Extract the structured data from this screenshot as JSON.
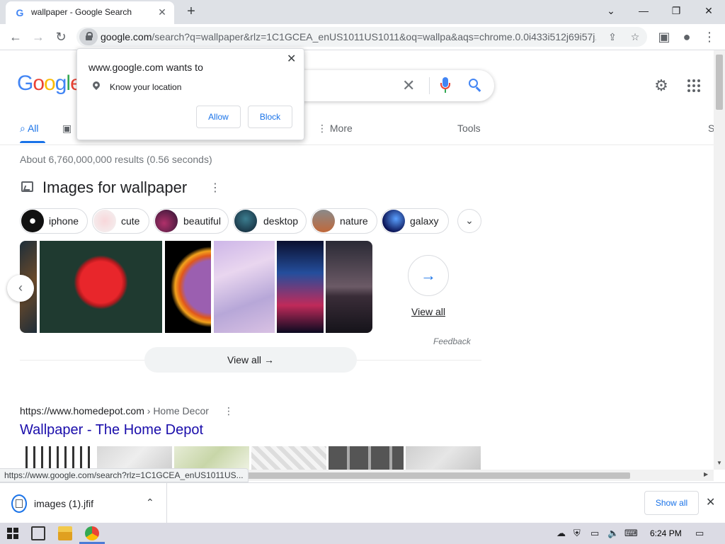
{
  "browser": {
    "tab_title": "wallpaper - Google Search",
    "favicon_letter": "G",
    "url_host": "google.com",
    "url_rest": "/search?q=wallpaper&rlz=1C1GCEA_enUS1011US1011&oq=wallpa&aqs=chrome.0.0i433i512j69i57j..."
  },
  "google": {
    "logo_letters": [
      "G",
      "o",
      "o",
      "g",
      "l",
      "e"
    ],
    "logo_colors": [
      "#4285f4",
      "#ea4335",
      "#fbbc05",
      "#4285f4",
      "#34a853",
      "#ea4335"
    ],
    "tabs": {
      "all": "All",
      "more": "More",
      "tools": "Tools",
      "safesearch_partial": "S"
    },
    "result_stats": "About 6,760,000,000 results (0.56 seconds)",
    "images_header": "Images for wallpaper",
    "chips": [
      {
        "label": "iphone"
      },
      {
        "label": "cute"
      },
      {
        "label": "beautiful"
      },
      {
        "label": "desktop"
      },
      {
        "label": "nature"
      },
      {
        "label": "galaxy"
      }
    ],
    "view_all_link": "View all",
    "feedback": "Feedback",
    "view_all_button": "View all",
    "result": {
      "cite_url": "https://www.homedepot.com",
      "cite_crumb": "› Home Decor",
      "title": "Wallpaper - The Home Depot"
    }
  },
  "permission_popup": {
    "heading": "www.google.com wants to",
    "permission": "Know your location",
    "allow": "Allow",
    "block": "Block"
  },
  "status_url": "https://www.google.com/search?rlz=1C1GCEA_enUS1011US...",
  "downloads": {
    "file_name": "images (1).jfif",
    "show_all": "Show all"
  },
  "taskbar": {
    "time": "6:24 PM"
  },
  "colors": {
    "link_blue": "#1a73e8",
    "result_title": "#1a0dab"
  }
}
